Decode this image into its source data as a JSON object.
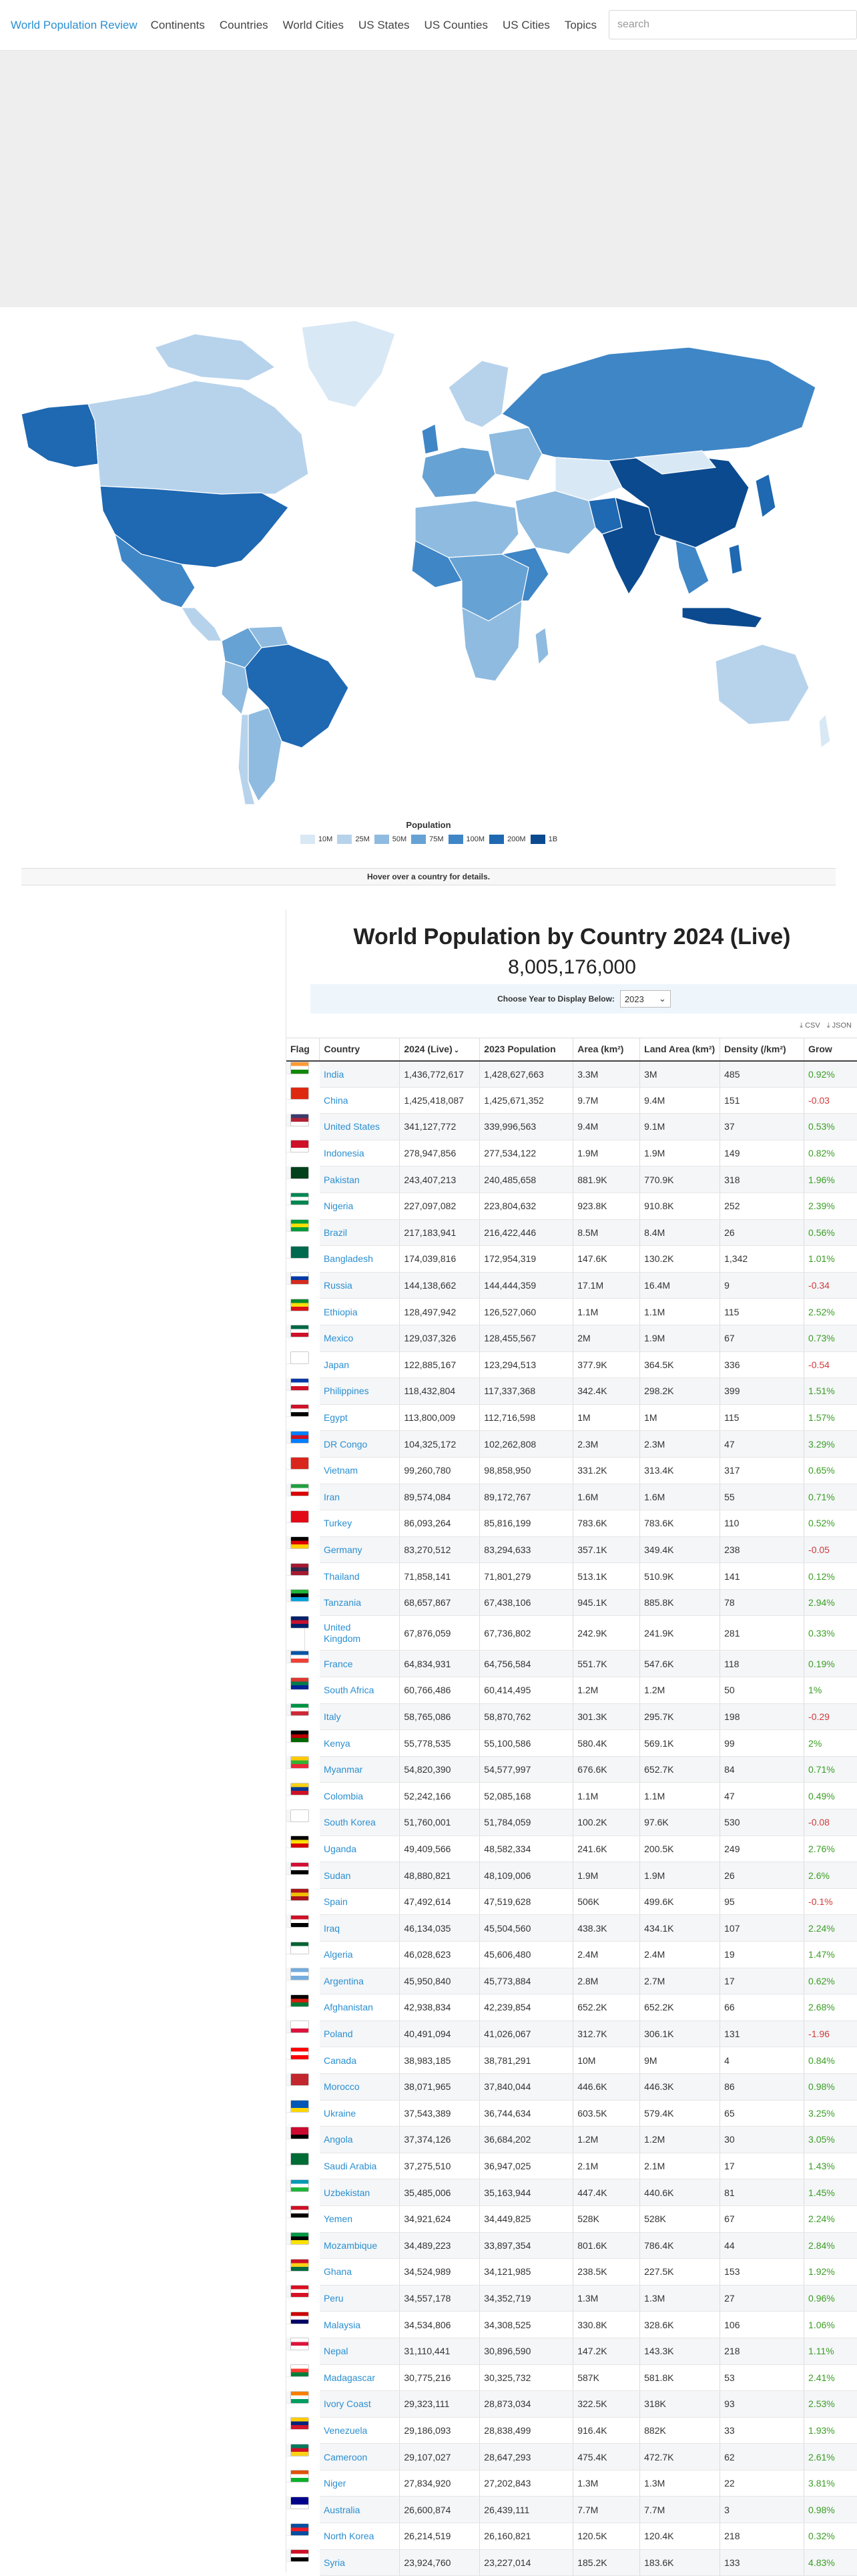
{
  "nav": {
    "brand": "World Population Review",
    "links": [
      "Continents",
      "Countries",
      "World Cities",
      "US States",
      "US Counties",
      "US Cities",
      "Topics"
    ],
    "search_placeholder": "search"
  },
  "map": {
    "legend_title": "Population",
    "legend": [
      {
        "label": "10M",
        "color": "#d9e8f5"
      },
      {
        "label": "25M",
        "color": "#b7d3ec"
      },
      {
        "label": "50M",
        "color": "#8fbbe0"
      },
      {
        "label": "75M",
        "color": "#67a2d4"
      },
      {
        "label": "100M",
        "color": "#3f86c6"
      },
      {
        "label": "200M",
        "color": "#1f68b2"
      },
      {
        "label": "1B",
        "color": "#0b4a8f"
      }
    ],
    "hover_text": "Hover over a country for details."
  },
  "main": {
    "title": "World Population by Country 2024 (Live)",
    "total": "8,005,176,000",
    "year_label": "Choose Year to Display Below:",
    "year_value": "2023",
    "export_csv": "CSV",
    "export_json": "JSON"
  },
  "table": {
    "headers": [
      "Flag",
      "Country",
      "2024 (Live)",
      "2023 Population",
      "Area (km²)",
      "Land Area (km²)",
      "Density (/km²)",
      "Grow"
    ],
    "rows": [
      {
        "country": "India",
        "live": "1,436,772,617",
        "pop2023": "1,428,627,663",
        "area": "3.3M",
        "land": "3M",
        "density": "485",
        "growth": "0.92%",
        "flag": [
          "#ff9933",
          "#ffffff",
          "#138808"
        ]
      },
      {
        "country": "China",
        "live": "1,425,418,087",
        "pop2023": "1,425,671,352",
        "area": "9.7M",
        "land": "9.4M",
        "density": "151",
        "growth": "-0.03",
        "flag": [
          "#de2910",
          "#de2910",
          "#de2910"
        ]
      },
      {
        "country": "United States",
        "live": "341,127,772",
        "pop2023": "339,996,563",
        "area": "9.4M",
        "land": "9.1M",
        "density": "37",
        "growth": "0.53%",
        "flag": [
          "#3c3b6e",
          "#b22234",
          "#ffffff"
        ]
      },
      {
        "country": "Indonesia",
        "live": "278,947,856",
        "pop2023": "277,534,122",
        "area": "1.9M",
        "land": "1.9M",
        "density": "149",
        "growth": "0.82%",
        "flag": [
          "#ce1126",
          "#ce1126",
          "#ffffff"
        ]
      },
      {
        "country": "Pakistan",
        "live": "243,407,213",
        "pop2023": "240,485,658",
        "area": "881.9K",
        "land": "770.9K",
        "density": "318",
        "growth": "1.96%",
        "flag": [
          "#01411c",
          "#01411c",
          "#01411c"
        ]
      },
      {
        "country": "Nigeria",
        "live": "227,097,082",
        "pop2023": "223,804,632",
        "area": "923.8K",
        "land": "910.8K",
        "density": "252",
        "growth": "2.39%",
        "flag": [
          "#008751",
          "#ffffff",
          "#008751"
        ]
      },
      {
        "country": "Brazil",
        "live": "217,183,941",
        "pop2023": "216,422,446",
        "area": "8.5M",
        "land": "8.4M",
        "density": "26",
        "growth": "0.56%",
        "flag": [
          "#009c3b",
          "#ffdf00",
          "#009c3b"
        ]
      },
      {
        "country": "Bangladesh",
        "live": "174,039,816",
        "pop2023": "172,954,319",
        "area": "147.6K",
        "land": "130.2K",
        "density": "1,342",
        "growth": "1.01%",
        "flag": [
          "#006a4e",
          "#006a4e",
          "#006a4e"
        ]
      },
      {
        "country": "Russia",
        "live": "144,138,662",
        "pop2023": "144,444,359",
        "area": "17.1M",
        "land": "16.4M",
        "density": "9",
        "growth": "-0.34",
        "flag": [
          "#ffffff",
          "#0039a6",
          "#d52b1e"
        ]
      },
      {
        "country": "Ethiopia",
        "live": "128,497,942",
        "pop2023": "126,527,060",
        "area": "1.1M",
        "land": "1.1M",
        "density": "115",
        "growth": "2.52%",
        "flag": [
          "#078930",
          "#fcdd09",
          "#da121a"
        ]
      },
      {
        "country": "Mexico",
        "live": "129,037,326",
        "pop2023": "128,455,567",
        "area": "2M",
        "land": "1.9M",
        "density": "67",
        "growth": "0.73%",
        "flag": [
          "#006847",
          "#ffffff",
          "#ce1126"
        ]
      },
      {
        "country": "Japan",
        "live": "122,885,167",
        "pop2023": "123,294,513",
        "area": "377.9K",
        "land": "364.5K",
        "density": "336",
        "growth": "-0.54",
        "flag": [
          "#ffffff",
          "#ffffff",
          "#ffffff"
        ]
      },
      {
        "country": "Philippines",
        "live": "118,432,804",
        "pop2023": "117,337,368",
        "area": "342.4K",
        "land": "298.2K",
        "density": "399",
        "growth": "1.51%",
        "flag": [
          "#0038a8",
          "#ffffff",
          "#ce1126"
        ]
      },
      {
        "country": "Egypt",
        "live": "113,800,009",
        "pop2023": "112,716,598",
        "area": "1M",
        "land": "1M",
        "density": "115",
        "growth": "1.57%",
        "flag": [
          "#ce1126",
          "#ffffff",
          "#000000"
        ]
      },
      {
        "country": "DR Congo",
        "live": "104,325,172",
        "pop2023": "102,262,808",
        "area": "2.3M",
        "land": "2.3M",
        "density": "47",
        "growth": "3.29%",
        "flag": [
          "#007fff",
          "#ce1021",
          "#007fff"
        ]
      },
      {
        "country": "Vietnam",
        "live": "99,260,780",
        "pop2023": "98,858,950",
        "area": "331.2K",
        "land": "313.4K",
        "density": "317",
        "growth": "0.65%",
        "flag": [
          "#da251d",
          "#da251d",
          "#da251d"
        ]
      },
      {
        "country": "Iran",
        "live": "89,574,084",
        "pop2023": "89,172,767",
        "area": "1.6M",
        "land": "1.6M",
        "density": "55",
        "growth": "0.71%",
        "flag": [
          "#239f40",
          "#ffffff",
          "#da0000"
        ]
      },
      {
        "country": "Turkey",
        "live": "86,093,264",
        "pop2023": "85,816,199",
        "area": "783.6K",
        "land": "783.6K",
        "density": "110",
        "growth": "0.52%",
        "flag": [
          "#e30a17",
          "#e30a17",
          "#e30a17"
        ]
      },
      {
        "country": "Germany",
        "live": "83,270,512",
        "pop2023": "83,294,633",
        "area": "357.1K",
        "land": "349.4K",
        "density": "238",
        "growth": "-0.05",
        "flag": [
          "#000000",
          "#dd0000",
          "#ffce00"
        ]
      },
      {
        "country": "Thailand",
        "live": "71,858,141",
        "pop2023": "71,801,279",
        "area": "513.1K",
        "land": "510.9K",
        "density": "141",
        "growth": "0.12%",
        "flag": [
          "#a51931",
          "#2d2a4a",
          "#a51931"
        ]
      },
      {
        "country": "Tanzania",
        "live": "68,657,867",
        "pop2023": "67,438,106",
        "area": "945.1K",
        "land": "885.8K",
        "density": "78",
        "growth": "2.94%",
        "flag": [
          "#1eb53a",
          "#000000",
          "#00a3dd"
        ]
      },
      {
        "country": "United Kingdom",
        "live": "67,876,059",
        "pop2023": "67,736,802",
        "area": "242.9K",
        "land": "241.9K",
        "density": "281",
        "growth": "0.33%",
        "flag": [
          "#012169",
          "#c8102e",
          "#012169"
        ]
      },
      {
        "country": "France",
        "live": "64,834,931",
        "pop2023": "64,756,584",
        "area": "551.7K",
        "land": "547.6K",
        "density": "118",
        "growth": "0.19%",
        "flag": [
          "#0055a4",
          "#ffffff",
          "#ef4135"
        ]
      },
      {
        "country": "South Africa",
        "live": "60,766,486",
        "pop2023": "60,414,495",
        "area": "1.2M",
        "land": "1.2M",
        "density": "50",
        "growth": "1%",
        "flag": [
          "#de3831",
          "#007a4d",
          "#002395"
        ]
      },
      {
        "country": "Italy",
        "live": "58,765,086",
        "pop2023": "58,870,762",
        "area": "301.3K",
        "land": "295.7K",
        "density": "198",
        "growth": "-0.29",
        "flag": [
          "#009246",
          "#ffffff",
          "#ce2b37"
        ]
      },
      {
        "country": "Kenya",
        "live": "55,778,535",
        "pop2023": "55,100,586",
        "area": "580.4K",
        "land": "569.1K",
        "density": "99",
        "growth": "2%",
        "flag": [
          "#000000",
          "#bb0000",
          "#006600"
        ]
      },
      {
        "country": "Myanmar",
        "live": "54,820,390",
        "pop2023": "54,577,997",
        "area": "676.6K",
        "land": "652.7K",
        "density": "84",
        "growth": "0.71%",
        "flag": [
          "#fecb00",
          "#34b233",
          "#ea2839"
        ]
      },
      {
        "country": "Colombia",
        "live": "52,242,166",
        "pop2023": "52,085,168",
        "area": "1.1M",
        "land": "1.1M",
        "density": "47",
        "growth": "0.49%",
        "flag": [
          "#fcd116",
          "#003893",
          "#ce1126"
        ]
      },
      {
        "country": "South Korea",
        "live": "51,760,001",
        "pop2023": "51,784,059",
        "area": "100.2K",
        "land": "97.6K",
        "density": "530",
        "growth": "-0.08",
        "flag": [
          "#ffffff",
          "#ffffff",
          "#ffffff"
        ]
      },
      {
        "country": "Uganda",
        "live": "49,409,566",
        "pop2023": "48,582,334",
        "area": "241.6K",
        "land": "200.5K",
        "density": "249",
        "growth": "2.76%",
        "flag": [
          "#000000",
          "#fcdc04",
          "#d90000"
        ]
      },
      {
        "country": "Sudan",
        "live": "48,880,821",
        "pop2023": "48,109,006",
        "area": "1.9M",
        "land": "1.9M",
        "density": "26",
        "growth": "2.6%",
        "flag": [
          "#d21034",
          "#ffffff",
          "#000000"
        ]
      },
      {
        "country": "Spain",
        "live": "47,492,614",
        "pop2023": "47,519,628",
        "area": "506K",
        "land": "499.6K",
        "density": "95",
        "growth": "-0.1%",
        "flag": [
          "#aa151b",
          "#f1bf00",
          "#aa151b"
        ]
      },
      {
        "country": "Iraq",
        "live": "46,134,035",
        "pop2023": "45,504,560",
        "area": "438.3K",
        "land": "434.1K",
        "density": "107",
        "growth": "2.24%",
        "flag": [
          "#ce1126",
          "#ffffff",
          "#000000"
        ]
      },
      {
        "country": "Algeria",
        "live": "46,028,623",
        "pop2023": "45,606,480",
        "area": "2.4M",
        "land": "2.4M",
        "density": "19",
        "growth": "1.47%",
        "flag": [
          "#006233",
          "#ffffff",
          "#ffffff"
        ]
      },
      {
        "country": "Argentina",
        "live": "45,950,840",
        "pop2023": "45,773,884",
        "area": "2.8M",
        "land": "2.7M",
        "density": "17",
        "growth": "0.62%",
        "flag": [
          "#74acdf",
          "#ffffff",
          "#74acdf"
        ]
      },
      {
        "country": "Afghanistan",
        "live": "42,938,834",
        "pop2023": "42,239,854",
        "area": "652.2K",
        "land": "652.2K",
        "density": "66",
        "growth": "2.68%",
        "flag": [
          "#000000",
          "#d32011",
          "#007a36"
        ]
      },
      {
        "country": "Poland",
        "live": "40,491,094",
        "pop2023": "41,026,067",
        "area": "312.7K",
        "land": "306.1K",
        "density": "131",
        "growth": "-1.96",
        "flag": [
          "#ffffff",
          "#ffffff",
          "#dc143c"
        ]
      },
      {
        "country": "Canada",
        "live": "38,983,185",
        "pop2023": "38,781,291",
        "area": "10M",
        "land": "9M",
        "density": "4",
        "growth": "0.84%",
        "flag": [
          "#ff0000",
          "#ffffff",
          "#ff0000"
        ]
      },
      {
        "country": "Morocco",
        "live": "38,071,965",
        "pop2023": "37,840,044",
        "area": "446.6K",
        "land": "446.3K",
        "density": "86",
        "growth": "0.98%",
        "flag": [
          "#c1272d",
          "#c1272d",
          "#c1272d"
        ]
      },
      {
        "country": "Ukraine",
        "live": "37,543,389",
        "pop2023": "36,744,634",
        "area": "603.5K",
        "land": "579.4K",
        "density": "65",
        "growth": "3.25%",
        "flag": [
          "#0057b7",
          "#0057b7",
          "#ffd700"
        ]
      },
      {
        "country": "Angola",
        "live": "37,374,126",
        "pop2023": "36,684,202",
        "area": "1.2M",
        "land": "1.2M",
        "density": "30",
        "growth": "3.05%",
        "flag": [
          "#cc092f",
          "#cc092f",
          "#000000"
        ]
      },
      {
        "country": "Saudi Arabia",
        "live": "37,275,510",
        "pop2023": "36,947,025",
        "area": "2.1M",
        "land": "2.1M",
        "density": "17",
        "growth": "1.43%",
        "flag": [
          "#006c35",
          "#006c35",
          "#006c35"
        ]
      },
      {
        "country": "Uzbekistan",
        "live": "35,485,006",
        "pop2023": "35,163,944",
        "area": "447.4K",
        "land": "440.6K",
        "density": "81",
        "growth": "1.45%",
        "flag": [
          "#0099b5",
          "#ffffff",
          "#1eb53a"
        ]
      },
      {
        "country": "Yemen",
        "live": "34,921,624",
        "pop2023": "34,449,825",
        "area": "528K",
        "land": "528K",
        "density": "67",
        "growth": "2.24%",
        "flag": [
          "#ce1126",
          "#ffffff",
          "#000000"
        ]
      },
      {
        "country": "Mozambique",
        "live": "34,489,223",
        "pop2023": "33,897,354",
        "area": "801.6K",
        "land": "786.4K",
        "density": "44",
        "growth": "2.84%",
        "flag": [
          "#009a44",
          "#000000",
          "#fce100"
        ]
      },
      {
        "country": "Ghana",
        "live": "34,524,989",
        "pop2023": "34,121,985",
        "area": "238.5K",
        "land": "227.5K",
        "density": "153",
        "growth": "1.92%",
        "flag": [
          "#ce1126",
          "#fcd116",
          "#006b3f"
        ]
      },
      {
        "country": "Peru",
        "live": "34,557,178",
        "pop2023": "34,352,719",
        "area": "1.3M",
        "land": "1.3M",
        "density": "27",
        "growth": "0.96%",
        "flag": [
          "#d91023",
          "#ffffff",
          "#d91023"
        ]
      },
      {
        "country": "Malaysia",
        "live": "34,534,806",
        "pop2023": "34,308,525",
        "area": "330.8K",
        "land": "328.6K",
        "density": "106",
        "growth": "1.06%",
        "flag": [
          "#cc0001",
          "#ffffff",
          "#010066"
        ]
      },
      {
        "country": "Nepal",
        "live": "31,110,441",
        "pop2023": "30,896,590",
        "area": "147.2K",
        "land": "143.3K",
        "density": "218",
        "growth": "1.11%",
        "flag": [
          "#ffffff",
          "#dc143c",
          "#ffffff"
        ]
      },
      {
        "country": "Madagascar",
        "live": "30,775,216",
        "pop2023": "30,325,732",
        "area": "587K",
        "land": "581.8K",
        "density": "53",
        "growth": "2.41%",
        "flag": [
          "#ffffff",
          "#fc3d32",
          "#007e3a"
        ]
      },
      {
        "country": "Ivory Coast",
        "live": "29,323,111",
        "pop2023": "28,873,034",
        "area": "322.5K",
        "land": "318K",
        "density": "93",
        "growth": "2.53%",
        "flag": [
          "#f77f00",
          "#ffffff",
          "#009e60"
        ]
      },
      {
        "country": "Venezuela",
        "live": "29,186,093",
        "pop2023": "28,838,499",
        "area": "916.4K",
        "land": "882K",
        "density": "33",
        "growth": "1.93%",
        "flag": [
          "#ffcc00",
          "#00247d",
          "#cf142b"
        ]
      },
      {
        "country": "Cameroon",
        "live": "29,107,027",
        "pop2023": "28,647,293",
        "area": "475.4K",
        "land": "472.7K",
        "density": "62",
        "growth": "2.61%",
        "flag": [
          "#007a5e",
          "#ce1126",
          "#fcd116"
        ]
      },
      {
        "country": "Niger",
        "live": "27,834,920",
        "pop2023": "27,202,843",
        "area": "1.3M",
        "land": "1.3M",
        "density": "22",
        "growth": "3.81%",
        "flag": [
          "#e05206",
          "#ffffff",
          "#0db02b"
        ]
      },
      {
        "country": "Australia",
        "live": "26,600,874",
        "pop2023": "26,439,111",
        "area": "7.7M",
        "land": "7.7M",
        "density": "3",
        "growth": "0.98%",
        "flag": [
          "#00008b",
          "#00008b",
          "#ffffff"
        ]
      },
      {
        "country": "North Korea",
        "live": "26,214,519",
        "pop2023": "26,160,821",
        "area": "120.5K",
        "land": "120.4K",
        "density": "218",
        "growth": "0.32%",
        "flag": [
          "#024fa2",
          "#ed1c27",
          "#024fa2"
        ]
      },
      {
        "country": "Syria",
        "live": "23,924,760",
        "pop2023": "23,227,014",
        "area": "185.2K",
        "land": "183.6K",
        "density": "133",
        "growth": "4.83%",
        "flag": [
          "#ce1126",
          "#ffffff",
          "#000000"
        ]
      }
    ]
  }
}
